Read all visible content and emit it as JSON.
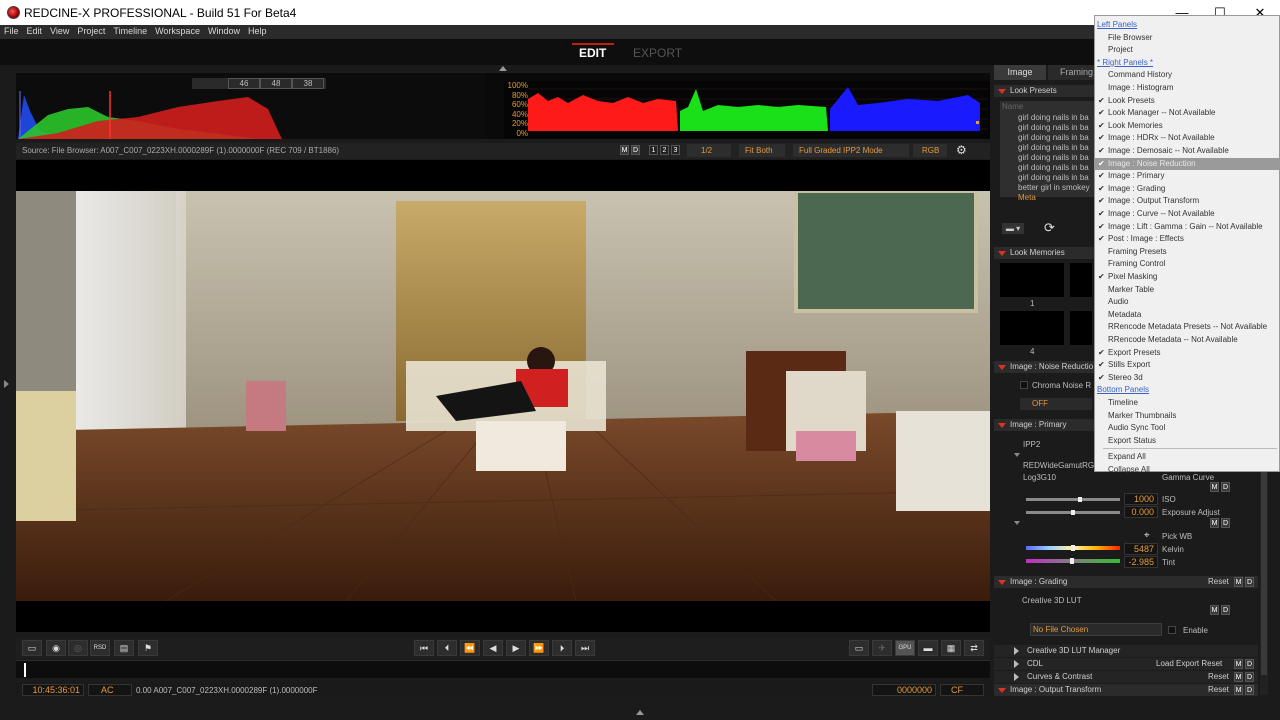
{
  "window": {
    "title": "REDCINE-X PROFESSIONAL - Build 51 For Beta4",
    "minimize": "—",
    "maximize": "☐",
    "close": "✕"
  },
  "menu": [
    "File",
    "Edit",
    "View",
    "Project",
    "Timeline",
    "Workspace",
    "Window",
    "Help"
  ],
  "modes": {
    "edit": "EDIT",
    "export": "EXPORT"
  },
  "scopes": {
    "histogram_values": [
      "46",
      "48",
      "38"
    ],
    "waveform_scale": [
      "100%",
      "80%",
      "60%",
      "40%",
      "20%",
      "0%"
    ]
  },
  "infobar": {
    "source": "Source: File Browser: A007_C007_0223XH.0000289F (1).0000000F     (REC 709 / BT1886)",
    "m": "M",
    "d": "D",
    "views": [
      "1",
      "2",
      "3"
    ],
    "scale": "1/2",
    "fit": "Fit Both",
    "mode": "Full Graded IPP2 Mode",
    "channel": "RGB"
  },
  "transport": {
    "left_buttons": [
      "clip-icon",
      "camera-icon",
      "snapshot-icon",
      "rsd-icon",
      "export-frame-icon",
      "flag-icon"
    ],
    "nav": [
      "⏮",
      "⏴",
      "⏪",
      "◀",
      "▶",
      "⏩",
      "⏵",
      "⏭"
    ]
  },
  "status": {
    "timecode": "10:45:36:01",
    "ac": "AC",
    "clip": "0.00 A007_C007_0223XH.0000289F (1).0000000F",
    "frame": "0000000",
    "cf": "CF"
  },
  "right": {
    "tabs": [
      "Image",
      "Framing"
    ],
    "look_presets": {
      "header": "Look Presets",
      "name_placeholder": "Name",
      "items": [
        "girl doing nails in ba",
        "girl doing nails in ba",
        "girl doing nails in ba",
        "girl doing nails in ba",
        "girl doing nails in ba",
        "girl doing nails in ba",
        "girl doing nails in ba",
        "better girl in smokey",
        "Meta"
      ]
    },
    "look_memories": {
      "header": "Look Memories",
      "slots": [
        "1",
        "4"
      ]
    },
    "noise": {
      "header": "Image : Noise Reductio",
      "chroma": "Chroma Noise R",
      "value": "OFF"
    },
    "primary": {
      "header": "Image : Primary",
      "ipp2": "IPP2",
      "colorspace": "REDWideGamutRG",
      "gamma": "Log3G10",
      "gamma_label": "Gamma Curve",
      "iso_value": "1000",
      "iso_label": "ISO",
      "exposure_value": "0.000",
      "exposure_label": "Exposure Adjust",
      "pick_wb": "Pick WB",
      "kelvin_value": "5487",
      "kelvin_label": "Kelvin",
      "tint_value": "-2.985",
      "tint_label": "Tint"
    },
    "grading": {
      "header": "Image : Grading",
      "reset": "Reset",
      "lut_label": "Creative 3D LUT",
      "lut_value": "No File Chosen",
      "enable": "Enable"
    },
    "collapsed": [
      {
        "label": "Creative 3D LUT Manager",
        "extra": ""
      },
      {
        "label": "CDL",
        "extra": "Load  Export  Reset"
      },
      {
        "label": "Curves & Contrast",
        "extra": "Reset"
      }
    ],
    "output": {
      "header": "Image : Output Transform",
      "reset": "Reset"
    }
  },
  "context_menu": {
    "items": [
      {
        "label": "Left Panels",
        "type": "header"
      },
      {
        "label": "File Browser",
        "checked": false
      },
      {
        "label": "Project",
        "checked": false
      },
      {
        "label": "* Right Panels *",
        "type": "header"
      },
      {
        "label": "Command History",
        "checked": false
      },
      {
        "label": "Image : Histogram",
        "checked": false
      },
      {
        "label": "Look Presets",
        "checked": true
      },
      {
        "label": "Look Manager -- Not Available",
        "checked": true
      },
      {
        "label": "Look Memories",
        "checked": true
      },
      {
        "label": "Image : HDRx -- Not Available",
        "checked": true
      },
      {
        "label": "Image : Demosaic -- Not Available",
        "checked": true
      },
      {
        "label": "Image : Noise Reduction",
        "checked": true,
        "selected": true
      },
      {
        "label": "Image : Primary",
        "checked": true
      },
      {
        "label": "Image : Grading",
        "checked": true
      },
      {
        "label": "Image : Output Transform",
        "checked": true
      },
      {
        "label": "Image : Curve -- Not Available",
        "checked": true
      },
      {
        "label": "Image : Lift : Gamma : Gain -- Not Available",
        "checked": true
      },
      {
        "label": "Post : Image : Effects",
        "checked": true
      },
      {
        "label": "Framing Presets",
        "checked": false
      },
      {
        "label": "Framing Control",
        "checked": false
      },
      {
        "label": "Pixel Masking",
        "checked": true
      },
      {
        "label": "Marker Table",
        "checked": false
      },
      {
        "label": "Audio",
        "checked": false
      },
      {
        "label": "Metadata",
        "checked": false
      },
      {
        "label": "RRencode Metadata Presets -- Not Available",
        "checked": false
      },
      {
        "label": "RRencode Metadata -- Not Available",
        "checked": false
      },
      {
        "label": "Export Presets",
        "checked": true
      },
      {
        "label": "Stills Export",
        "checked": true
      },
      {
        "label": "Stereo 3d",
        "checked": true
      },
      {
        "label": "Bottom Panels",
        "type": "header"
      },
      {
        "label": "Timeline",
        "checked": false
      },
      {
        "label": "Marker Thumbnails",
        "checked": false
      },
      {
        "label": "Audio Sync Tool",
        "checked": false
      },
      {
        "label": "Export Status",
        "checked": false
      },
      {
        "label": "Expand All",
        "type": "action"
      },
      {
        "label": "Collapse All",
        "type": "action"
      }
    ]
  },
  "colors": {
    "accent_red": "#e03020",
    "value_orange": "#e59b3a",
    "edit_active": "#ffffff",
    "export_inactive": "#555555"
  }
}
